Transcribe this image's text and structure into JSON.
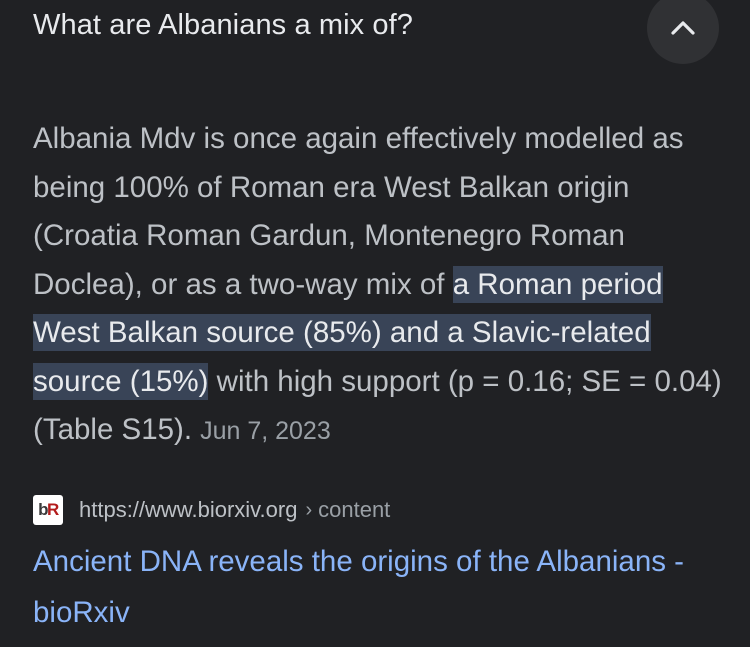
{
  "question": {
    "title": "What are Albanians a mix of?",
    "collapse_icon": "chevron-up-icon"
  },
  "snippet": {
    "text_before": "Albania Mdv is once again effectively modelled as being 100% of Roman era West Balkan origin (Croatia Roman Gardun, Montenegro Roman Doclea), or as a two-way mix of ",
    "highlight": "a Roman period West Balkan source (85%) and a Slavic-related source (15%)",
    "text_after": " with high support (p = 0.16; SE = 0.04) (Table S15).",
    "date": "Jun 7, 2023"
  },
  "source": {
    "favicon_b": "b",
    "favicon_r": "R",
    "url": "https://www.biorxiv.org",
    "separator": "›",
    "path": "content"
  },
  "result": {
    "title": "Ancient DNA reveals the origins of the Albanians - bioRxiv"
  },
  "colors": {
    "background": "#202124",
    "highlight_bg": "#394457",
    "link": "#8ab4f8",
    "body_text": "#bdc1c6"
  }
}
